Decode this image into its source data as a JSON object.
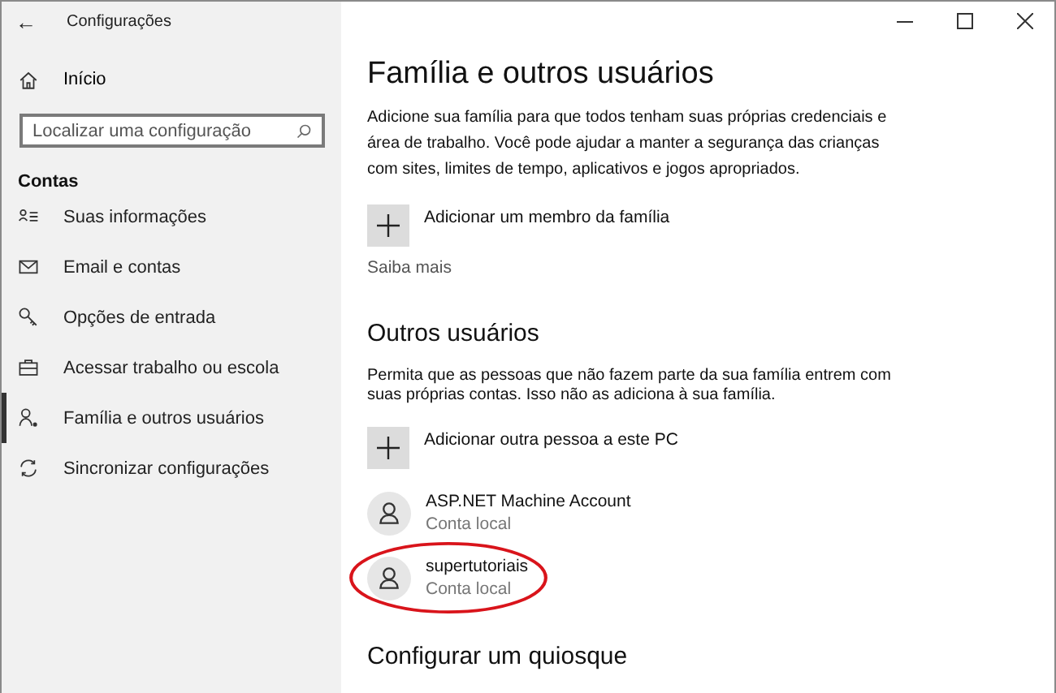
{
  "window": {
    "title": "Configurações",
    "back": "←"
  },
  "sidebar": {
    "home": "Início",
    "search": {
      "placeholder": "Localizar uma configuração"
    },
    "section": "Contas",
    "items": [
      {
        "label": "Suas informações",
        "kind": "info",
        "selected": false
      },
      {
        "label": "Email e contas",
        "kind": "mail",
        "selected": false
      },
      {
        "label": "Opções de entrada",
        "kind": "key",
        "selected": false
      },
      {
        "label": "Acessar trabalho ou escola",
        "kind": "briefcase",
        "selected": false
      },
      {
        "label": "Família e outros usuários",
        "kind": "person",
        "selected": true
      },
      {
        "label": "Sincronizar configurações",
        "kind": "sync",
        "selected": false
      }
    ]
  },
  "main": {
    "title": "Família e outros usuários",
    "family_description": "Adicione sua família para que todos tenham suas próprias credenciais e área de trabalho. Você pode ajudar a manter a segurança das crianças com sites, limites de tempo, aplicativos e jogos apropriados.",
    "add_family": "Adicionar um membro da família",
    "learn_more": "Saiba mais",
    "others_title": "Outros usuários",
    "others_description": "Permita que as pessoas que não fazem parte da sua família entrem com suas próprias contas. Isso não as adiciona à sua família.",
    "add_other": "Adicionar outra pessoa a este PC",
    "users": [
      {
        "name": "ASP.NET Machine Account",
        "type": "Conta local",
        "highlighted": false
      },
      {
        "name": "supertutoriais",
        "type": "Conta local",
        "highlighted": true
      }
    ],
    "kiosk_title": "Configurar um quiosque"
  }
}
